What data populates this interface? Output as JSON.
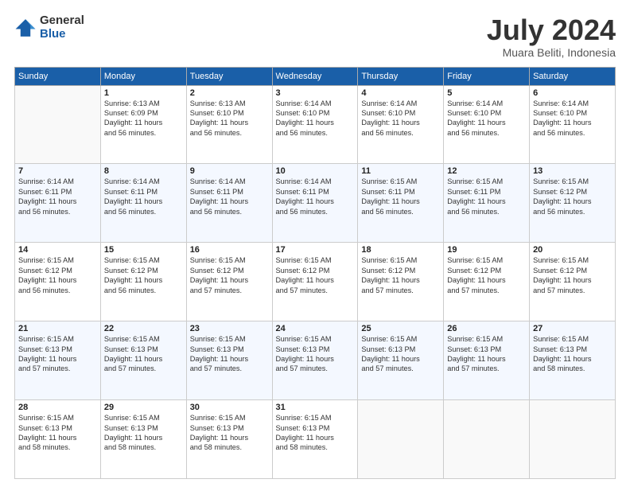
{
  "header": {
    "logo_general": "General",
    "logo_blue": "Blue",
    "month_title": "July 2024",
    "location": "Muara Beliti, Indonesia"
  },
  "days_of_week": [
    "Sunday",
    "Monday",
    "Tuesday",
    "Wednesday",
    "Thursday",
    "Friday",
    "Saturday"
  ],
  "weeks": [
    [
      {
        "day": "",
        "info": ""
      },
      {
        "day": "1",
        "info": "Sunrise: 6:13 AM\nSunset: 6:09 PM\nDaylight: 11 hours\nand 56 minutes."
      },
      {
        "day": "2",
        "info": "Sunrise: 6:13 AM\nSunset: 6:10 PM\nDaylight: 11 hours\nand 56 minutes."
      },
      {
        "day": "3",
        "info": "Sunrise: 6:14 AM\nSunset: 6:10 PM\nDaylight: 11 hours\nand 56 minutes."
      },
      {
        "day": "4",
        "info": "Sunrise: 6:14 AM\nSunset: 6:10 PM\nDaylight: 11 hours\nand 56 minutes."
      },
      {
        "day": "5",
        "info": "Sunrise: 6:14 AM\nSunset: 6:10 PM\nDaylight: 11 hours\nand 56 minutes."
      },
      {
        "day": "6",
        "info": "Sunrise: 6:14 AM\nSunset: 6:10 PM\nDaylight: 11 hours\nand 56 minutes."
      }
    ],
    [
      {
        "day": "7",
        "info": "Sunrise: 6:14 AM\nSunset: 6:11 PM\nDaylight: 11 hours\nand 56 minutes."
      },
      {
        "day": "8",
        "info": "Sunrise: 6:14 AM\nSunset: 6:11 PM\nDaylight: 11 hours\nand 56 minutes."
      },
      {
        "day": "9",
        "info": "Sunrise: 6:14 AM\nSunset: 6:11 PM\nDaylight: 11 hours\nand 56 minutes."
      },
      {
        "day": "10",
        "info": "Sunrise: 6:14 AM\nSunset: 6:11 PM\nDaylight: 11 hours\nand 56 minutes."
      },
      {
        "day": "11",
        "info": "Sunrise: 6:15 AM\nSunset: 6:11 PM\nDaylight: 11 hours\nand 56 minutes."
      },
      {
        "day": "12",
        "info": "Sunrise: 6:15 AM\nSunset: 6:11 PM\nDaylight: 11 hours\nand 56 minutes."
      },
      {
        "day": "13",
        "info": "Sunrise: 6:15 AM\nSunset: 6:12 PM\nDaylight: 11 hours\nand 56 minutes."
      }
    ],
    [
      {
        "day": "14",
        "info": "Sunrise: 6:15 AM\nSunset: 6:12 PM\nDaylight: 11 hours\nand 56 minutes."
      },
      {
        "day": "15",
        "info": "Sunrise: 6:15 AM\nSunset: 6:12 PM\nDaylight: 11 hours\nand 56 minutes."
      },
      {
        "day": "16",
        "info": "Sunrise: 6:15 AM\nSunset: 6:12 PM\nDaylight: 11 hours\nand 57 minutes."
      },
      {
        "day": "17",
        "info": "Sunrise: 6:15 AM\nSunset: 6:12 PM\nDaylight: 11 hours\nand 57 minutes."
      },
      {
        "day": "18",
        "info": "Sunrise: 6:15 AM\nSunset: 6:12 PM\nDaylight: 11 hours\nand 57 minutes."
      },
      {
        "day": "19",
        "info": "Sunrise: 6:15 AM\nSunset: 6:12 PM\nDaylight: 11 hours\nand 57 minutes."
      },
      {
        "day": "20",
        "info": "Sunrise: 6:15 AM\nSunset: 6:12 PM\nDaylight: 11 hours\nand 57 minutes."
      }
    ],
    [
      {
        "day": "21",
        "info": "Sunrise: 6:15 AM\nSunset: 6:13 PM\nDaylight: 11 hours\nand 57 minutes."
      },
      {
        "day": "22",
        "info": "Sunrise: 6:15 AM\nSunset: 6:13 PM\nDaylight: 11 hours\nand 57 minutes."
      },
      {
        "day": "23",
        "info": "Sunrise: 6:15 AM\nSunset: 6:13 PM\nDaylight: 11 hours\nand 57 minutes."
      },
      {
        "day": "24",
        "info": "Sunrise: 6:15 AM\nSunset: 6:13 PM\nDaylight: 11 hours\nand 57 minutes."
      },
      {
        "day": "25",
        "info": "Sunrise: 6:15 AM\nSunset: 6:13 PM\nDaylight: 11 hours\nand 57 minutes."
      },
      {
        "day": "26",
        "info": "Sunrise: 6:15 AM\nSunset: 6:13 PM\nDaylight: 11 hours\nand 57 minutes."
      },
      {
        "day": "27",
        "info": "Sunrise: 6:15 AM\nSunset: 6:13 PM\nDaylight: 11 hours\nand 58 minutes."
      }
    ],
    [
      {
        "day": "28",
        "info": "Sunrise: 6:15 AM\nSunset: 6:13 PM\nDaylight: 11 hours\nand 58 minutes."
      },
      {
        "day": "29",
        "info": "Sunrise: 6:15 AM\nSunset: 6:13 PM\nDaylight: 11 hours\nand 58 minutes."
      },
      {
        "day": "30",
        "info": "Sunrise: 6:15 AM\nSunset: 6:13 PM\nDaylight: 11 hours\nand 58 minutes."
      },
      {
        "day": "31",
        "info": "Sunrise: 6:15 AM\nSunset: 6:13 PM\nDaylight: 11 hours\nand 58 minutes."
      },
      {
        "day": "",
        "info": ""
      },
      {
        "day": "",
        "info": ""
      },
      {
        "day": "",
        "info": ""
      }
    ]
  ]
}
